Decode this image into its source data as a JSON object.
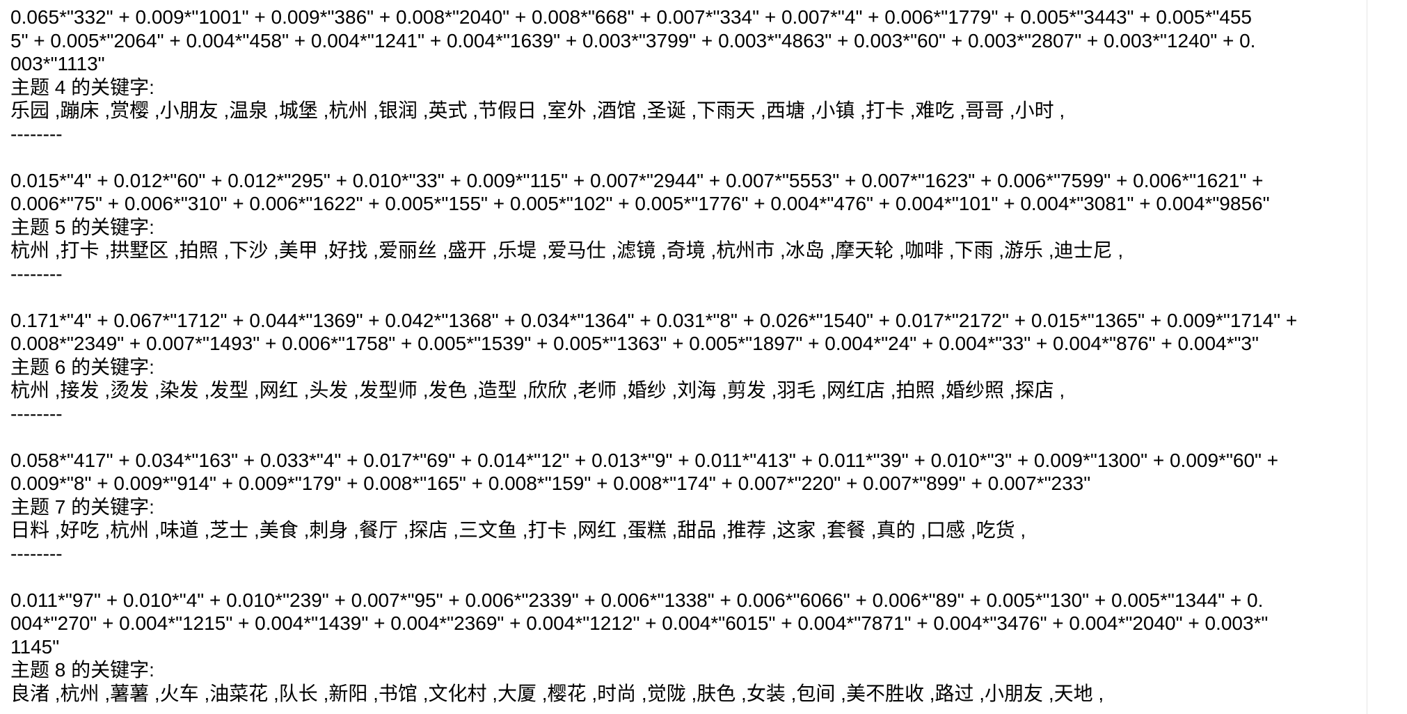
{
  "blocks": [
    {
      "weights": [
        "0.065*\"332\" + 0.009*\"1001\" + 0.009*\"386\" + 0.008*\"2040\" + 0.008*\"668\" + 0.007*\"334\" + 0.007*\"4\" + 0.006*\"1779\" + 0.005*\"3443\" + 0.005*\"455",
        "5\" + 0.005*\"2064\" + 0.004*\"458\" + 0.004*\"1241\" + 0.004*\"1639\" + 0.003*\"3799\" + 0.003*\"4863\" + 0.003*\"60\" + 0.003*\"2807\" + 0.003*\"1240\" + 0.",
        "003*\"1113\""
      ],
      "heading": "主题 4 的关键字:",
      "keywords": "乐园 ,蹦床 ,赏樱 ,小朋友 ,温泉 ,城堡 ,杭州 ,银润 ,英式 ,节假日 ,室外 ,酒馆 ,圣诞 ,下雨天 ,西塘 ,小镇 ,打卡 ,难吃 ,哥哥 ,小时 ,",
      "separator": "--------"
    },
    {
      "weights": [
        "0.015*\"4\" + 0.012*\"60\" + 0.012*\"295\" + 0.010*\"33\" + 0.009*\"115\" + 0.007*\"2944\" + 0.007*\"5553\" + 0.007*\"1623\" + 0.006*\"7599\" + 0.006*\"1621\" +",
        "0.006*\"75\" + 0.006*\"310\" + 0.006*\"1622\" + 0.005*\"155\" + 0.005*\"102\" + 0.005*\"1776\" + 0.004*\"476\" + 0.004*\"101\" + 0.004*\"3081\" + 0.004*\"9856\""
      ],
      "heading": "主题 5 的关键字:",
      "keywords": "杭州 ,打卡 ,拱墅区 ,拍照 ,下沙 ,美甲 ,好找 ,爱丽丝 ,盛开 ,乐堤 ,爱马仕 ,滤镜 ,奇境 ,杭州市 ,冰岛 ,摩天轮 ,咖啡 ,下雨 ,游乐 ,迪士尼 ,",
      "separator": "--------"
    },
    {
      "weights": [
        "0.171*\"4\" + 0.067*\"1712\" + 0.044*\"1369\" + 0.042*\"1368\" + 0.034*\"1364\" + 0.031*\"8\" + 0.026*\"1540\" + 0.017*\"2172\" + 0.015*\"1365\" + 0.009*\"1714\" +",
        "0.008*\"2349\" + 0.007*\"1493\" + 0.006*\"1758\" + 0.005*\"1539\" + 0.005*\"1363\" + 0.005*\"1897\" + 0.004*\"24\" + 0.004*\"33\" + 0.004*\"876\" + 0.004*\"3\""
      ],
      "heading": "主题 6 的关键字:",
      "keywords": "杭州 ,接发 ,烫发 ,染发 ,发型 ,网红 ,头发 ,发型师 ,发色 ,造型 ,欣欣 ,老师 ,婚纱 ,刘海 ,剪发 ,羽毛 ,网红店 ,拍照 ,婚纱照 ,探店 ,",
      "separator": "--------"
    },
    {
      "weights": [
        "0.058*\"417\" + 0.034*\"163\" + 0.033*\"4\" + 0.017*\"69\" + 0.014*\"12\" + 0.013*\"9\" + 0.011*\"413\" + 0.011*\"39\" + 0.010*\"3\" + 0.009*\"1300\" + 0.009*\"60\" +",
        "0.009*\"8\" + 0.009*\"914\" + 0.009*\"179\" + 0.008*\"165\" + 0.008*\"159\" + 0.008*\"174\" + 0.007*\"220\" + 0.007*\"899\" + 0.007*\"233\""
      ],
      "heading": "主题 7 的关键字:",
      "keywords": "日料 ,好吃 ,杭州 ,味道 ,芝士 ,美食 ,刺身 ,餐厅 ,探店 ,三文鱼 ,打卡 ,网红 ,蛋糕 ,甜品 ,推荐 ,这家 ,套餐 ,真的 ,口感 ,吃货 ,",
      "separator": "--------"
    },
    {
      "weights": [
        "0.011*\"97\" + 0.010*\"4\" + 0.010*\"239\" + 0.007*\"95\" + 0.006*\"2339\" + 0.006*\"1338\" + 0.006*\"6066\" + 0.006*\"89\" + 0.005*\"130\" + 0.005*\"1344\" + 0.",
        "004*\"270\" + 0.004*\"1215\" + 0.004*\"1439\" + 0.004*\"2369\" + 0.004*\"1212\" + 0.004*\"6015\" + 0.004*\"7871\" + 0.004*\"3476\" + 0.004*\"2040\" + 0.003*\"",
        "1145\""
      ],
      "heading": "主题 8 的关键字:",
      "keywords": "良渚 ,杭州 ,薯薯 ,火车 ,油菜花 ,队长 ,新阳 ,书馆 ,文化村 ,大厦 ,樱花 ,时尚 ,觉陇 ,肤色 ,女装 ,包间 ,美不胜收 ,路过 ,小朋友 ,天地 ,",
      "separator": ""
    }
  ]
}
